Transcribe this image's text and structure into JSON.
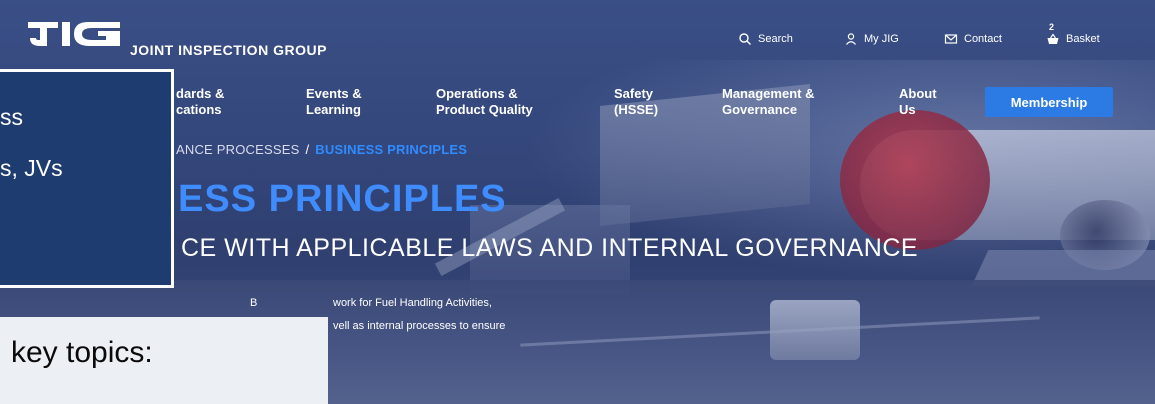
{
  "header": {
    "logo_icon": "jig-logo",
    "brand": "JOINT INSPECTION GROUP",
    "utility": {
      "search": "Search",
      "my_jig": "My JIG",
      "contact": "Contact",
      "basket": "Basket",
      "basket_count": "2"
    }
  },
  "nav": {
    "standards": [
      "dards &",
      "cations"
    ],
    "events": [
      "Events &",
      "Learning"
    ],
    "operations": [
      "Operations &",
      "Product Quality"
    ],
    "safety": [
      "Safety",
      "(HSSE)"
    ],
    "management": [
      "Management &",
      "Governance"
    ],
    "about": [
      "About",
      "Us"
    ],
    "membership": "Membership"
  },
  "breadcrumb": {
    "parent": "ANCE PROCESSES",
    "separator": "/",
    "current": "BUSINESS PRINCIPLES"
  },
  "hero": {
    "title": "ESS PRINCIPLES",
    "subtitle": "CE WITH APPLICABLE LAWS AND INTERNAL GOVERNANCE",
    "description_1a": "B",
    "description_1b": "work for Fuel Handling Activities,",
    "description_2": "vell as internal processes to ensure"
  },
  "overlay": {
    "line_1": "ss",
    "line_2": "s, JVs",
    "key_topics": "key topics:"
  },
  "colors": {
    "accent_blue": "#2f8cff",
    "membership_button": "#2c7be5",
    "overlay_box": "#1f3c70"
  }
}
